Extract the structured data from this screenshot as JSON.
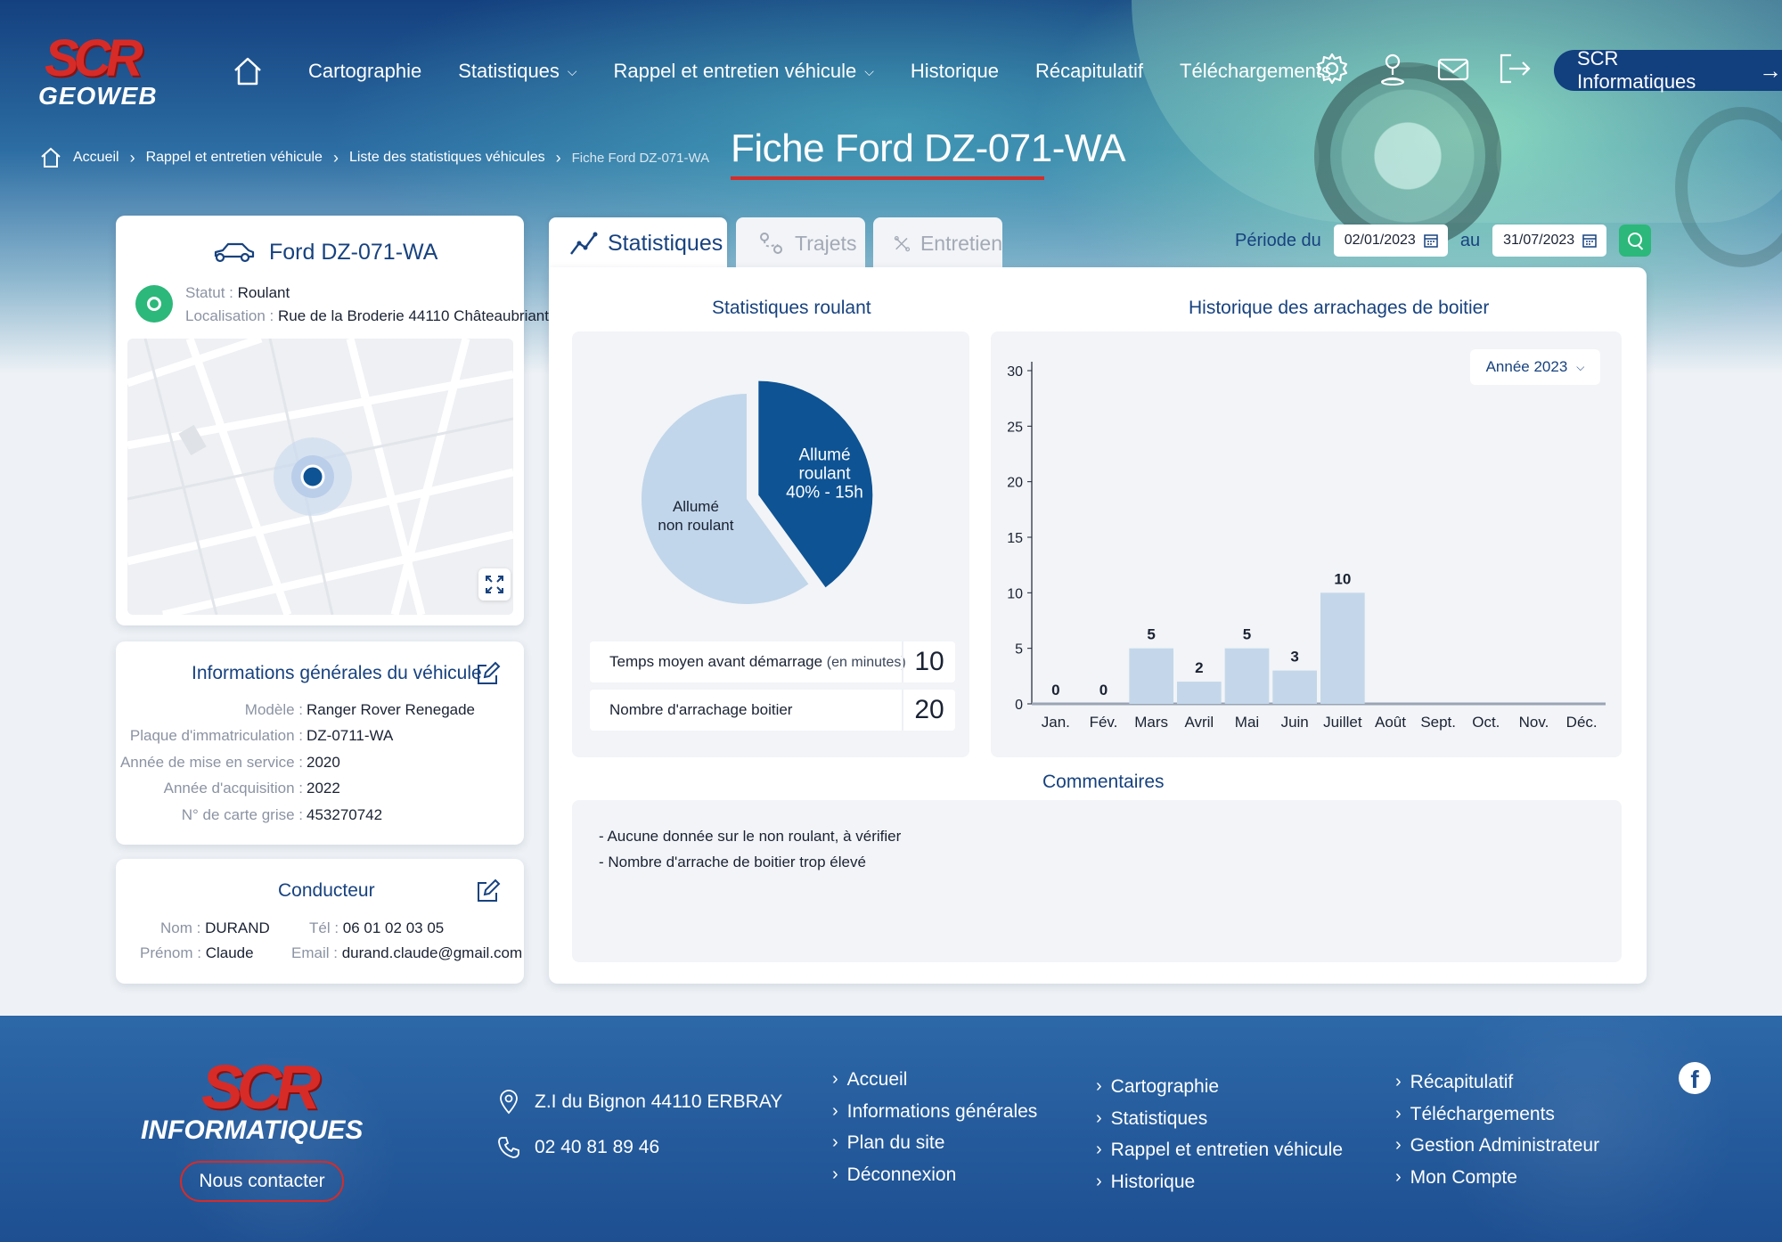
{
  "header": {
    "logo_main": "SCR",
    "logo_sub": "GEOWEB",
    "nav": [
      {
        "label": "Cartographie"
      },
      {
        "label": "Statistiques"
      },
      {
        "label": "Rappel et entretien véhicule"
      },
      {
        "label": "Historique"
      },
      {
        "label": "Récapitulatif"
      },
      {
        "label": "Téléchargements"
      }
    ],
    "icons": [
      "home-icon",
      "settings-icon",
      "user-location-icon",
      "mail-icon",
      "logout-icon"
    ],
    "company_button": "SCR Informatiques"
  },
  "breadcrumb": [
    "Accueil",
    "Rappel et entretien véhicule",
    "Liste des statistiques véhicules",
    "Fiche Ford DZ-071-WA"
  ],
  "page_title": "Fiche Ford DZ-071-WA",
  "vehicle": {
    "name": "Ford DZ-071-WA",
    "status_label": "Statut :",
    "status_value": "Roulant",
    "location_label": "Localisation :",
    "location_value": "Rue de la Broderie 44110 Châteaubriant"
  },
  "info": {
    "title": "Informations générales du véhicule",
    "rows": [
      {
        "label": "Modèle :",
        "value": "Ranger Rover Renegade"
      },
      {
        "label": "Plaque d'immatriculation :",
        "value": "DZ-0711-WA"
      },
      {
        "label": "Année de mise en service :",
        "value": "2020"
      },
      {
        "label": "Année d'acquisition :",
        "value": "2022"
      },
      {
        "label": "N° de carte grise :",
        "value": "453270742"
      }
    ]
  },
  "driver": {
    "title": "Conducteur",
    "nom_label": "Nom :",
    "nom": "DURAND",
    "prenom_label": "Prénom :",
    "prenom": "Claude",
    "tel_label": "Tél :",
    "tel": "06 01 02 03 05",
    "email_label": "Email :",
    "email": "durand.claude@gmail.com"
  },
  "tabs": [
    {
      "label": "Statistiques",
      "active": true
    },
    {
      "label": "Trajets",
      "active": false
    },
    {
      "label": "Entretien",
      "active": false
    }
  ],
  "period": {
    "from_label": "Période du",
    "from": "02/01/2023",
    "to_label": "au",
    "to": "31/07/2023"
  },
  "stats": {
    "pie_title": "Statistiques roulant",
    "bar_title": "Historique des arrachages de boitier",
    "year_select": "Année 2023",
    "stat_rows": [
      {
        "label": "Temps moyen avant démarrage",
        "unit": "(en minutes)",
        "value": "10"
      },
      {
        "label": "Nombre d'arrachage boitier",
        "unit": "",
        "value": "20"
      }
    ],
    "comments_title": "Commentaires",
    "comments": [
      "- Aucune donnée sur le non roulant, à vérifier",
      "- Nombre d'arrache de boitier trop élevé"
    ]
  },
  "chart_data": [
    {
      "type": "pie",
      "labels": [
        "Allumé roulant",
        "Allumé non roulant"
      ],
      "values": [
        40,
        60
      ],
      "slice_labels": [
        [
          "Allumé",
          "roulant",
          "40% - 15h"
        ],
        [
          "Allumé",
          "non roulant"
        ]
      ],
      "colors": [
        "#0e5394",
        "#c1d6ea"
      ]
    },
    {
      "type": "bar",
      "categories": [
        "Jan.",
        "Fév.",
        "Mars",
        "Avril",
        "Mai",
        "Juin",
        "Juillet",
        "Août",
        "Sept.",
        "Oct.",
        "Nov.",
        "Déc."
      ],
      "values": [
        0,
        0,
        5,
        2,
        5,
        3,
        10,
        null,
        null,
        null,
        null,
        null
      ],
      "ylim": [
        0,
        30
      ],
      "yticks": [
        0,
        5,
        10,
        15,
        20,
        25,
        30
      ],
      "bar_color": "#c4d7ea",
      "grid": false
    }
  ],
  "footer": {
    "logo_main": "SCR",
    "logo_sub": "INFORMATIQUES",
    "contact_button": "Nous contacter",
    "address": "Z.I du Bignon 44110 ERBRAY",
    "phone": "02 40 81 89 46",
    "col1": [
      "Accueil",
      "Informations générales",
      "Plan du site",
      "Déconnexion"
    ],
    "col2": [
      "Cartographie",
      "Statistiques",
      "Rappel et entretien véhicule",
      "Historique"
    ],
    "col3": [
      "Récapitulatif",
      "Téléchargements",
      "Gestion Administrateur",
      "Mon Compte"
    ],
    "social_icon": "facebook-icon"
  }
}
